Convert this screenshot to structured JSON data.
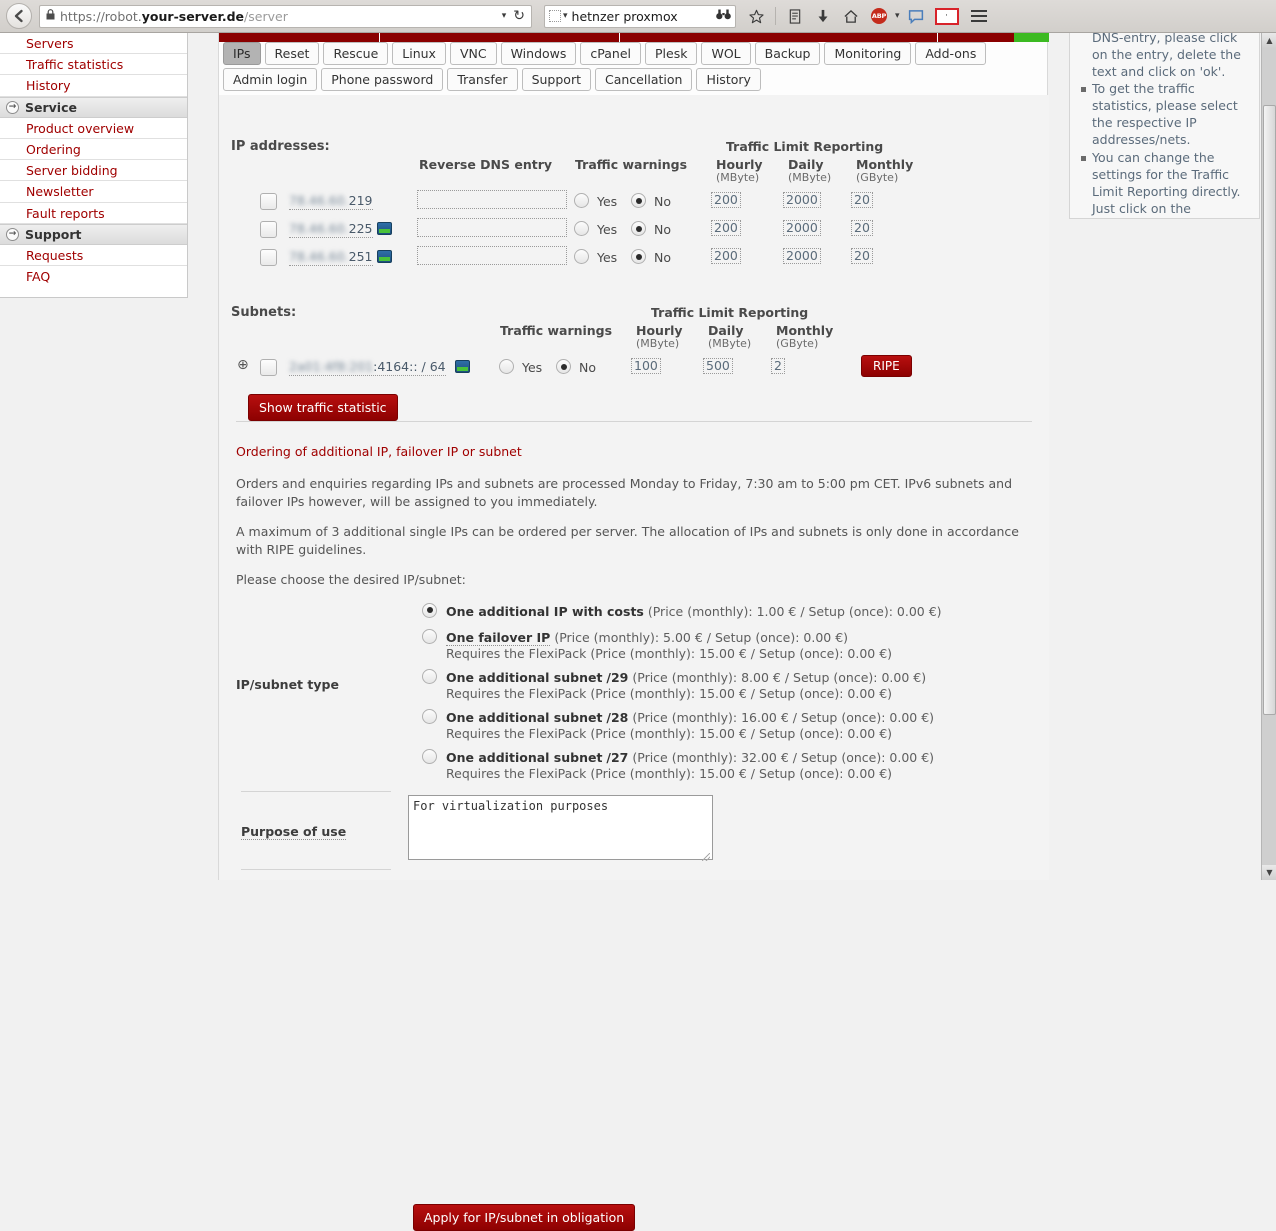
{
  "browser": {
    "back_label": "←",
    "url_scheme": "https://robot.",
    "url_domain": "your-server.de",
    "url_path": "/server",
    "url_full": "https://robot.your-server.de/server",
    "search_value": "hetnzer proxmox",
    "toolbar_icons": [
      "bookmark-star-icon",
      "library-icon",
      "downloads-icon",
      "home-icon",
      "adblock-icon",
      "chat-icon",
      "flag-icon",
      "menu-icon"
    ],
    "adblock_label": "ABP",
    "flag_label": "·"
  },
  "sidebar": {
    "items": [
      {
        "label": "Servers",
        "type": "link"
      },
      {
        "label": "Traffic statistics",
        "type": "link"
      },
      {
        "label": "History",
        "type": "link"
      },
      {
        "label": "Service",
        "type": "group"
      },
      {
        "label": "Product overview",
        "type": "link"
      },
      {
        "label": "Ordering",
        "type": "link"
      },
      {
        "label": "Server bidding",
        "type": "link"
      },
      {
        "label": "Newsletter",
        "type": "link"
      },
      {
        "label": "Fault reports",
        "type": "link"
      },
      {
        "label": "Support",
        "type": "group"
      },
      {
        "label": "Requests",
        "type": "link"
      },
      {
        "label": "FAQ",
        "type": "link"
      }
    ]
  },
  "tabs": {
    "row1": [
      "IPs",
      "Reset",
      "Rescue",
      "Linux",
      "VNC",
      "Windows",
      "cPanel",
      "Plesk",
      "WOL",
      "Backup",
      "Monitoring",
      "Add-ons"
    ],
    "row2": [
      "Admin login",
      "Phone password",
      "Transfer",
      "Support",
      "Cancellation",
      "History"
    ],
    "active": "IPs"
  },
  "ip_section": {
    "title": "IP addresses:",
    "headers": {
      "rdns": "Reverse DNS entry",
      "traffic_warnings": "Traffic warnings",
      "traffic_limit_reporting": "Traffic Limit Reporting",
      "hourly": "Hourly",
      "hourly_unit": "(MByte)",
      "daily": "Daily",
      "daily_unit": "(MByte)",
      "monthly": "Monthly",
      "monthly_unit": "(GByte)"
    },
    "yes_label": "Yes",
    "no_label": "No",
    "rows": [
      {
        "ip_blurred": "78.46.60.",
        "ip_visible": "219",
        "has_monitor_icon": false,
        "rdns": "",
        "warn_yes": false,
        "warn_no": true,
        "hourly": "200",
        "daily": "2000",
        "monthly": "20"
      },
      {
        "ip_blurred": "78.46.60.",
        "ip_visible": "225",
        "has_monitor_icon": true,
        "rdns": "",
        "warn_yes": false,
        "warn_no": true,
        "hourly": "200",
        "daily": "2000",
        "monthly": "20"
      },
      {
        "ip_blurred": "78.46.60.",
        "ip_visible": "251",
        "has_monitor_icon": true,
        "rdns": "",
        "warn_yes": false,
        "warn_no": true,
        "hourly": "200",
        "daily": "2000",
        "monthly": "20"
      }
    ]
  },
  "subnet_section": {
    "title": "Subnets:",
    "headers": {
      "traffic_warnings": "Traffic warnings",
      "traffic_limit_reporting": "Traffic Limit Reporting",
      "hourly": "Hourly",
      "hourly_unit": "(MByte)",
      "daily": "Daily",
      "daily_unit": "(MByte)",
      "monthly": "Monthly",
      "monthly_unit": "(GByte)"
    },
    "yes_label": "Yes",
    "no_label": "No",
    "expand_icon": "⊕",
    "row": {
      "subnet_blurred": "2a01:4f8:201",
      "subnet_visible": ":4164:: / 64",
      "warn_yes": false,
      "warn_no": true,
      "hourly": "100",
      "daily": "500",
      "monthly": "2",
      "ripe_label": "RIPE"
    },
    "show_traffic_button": "Show traffic statistic"
  },
  "ordering": {
    "heading": "Ordering of additional IP, failover IP or subnet",
    "para1": "Orders and enquiries regarding IPs and subnets are processed Monday to Friday, 7:30 am to 5:00 pm CET. IPv6 subnets and failover IPs however, will be assigned to you immediately.",
    "para2": "A maximum of 3 additional single IPs can be ordered per server. The allocation of IPs and subnets is only done in accordance with RIPE guidelines.",
    "para3": "Please choose the desired IP/subnet:",
    "type_label": "IP/subnet type",
    "options": [
      {
        "name": "One additional IP with costs",
        "suffix": "",
        "price": "(Price (monthly): 1.00 € / Setup (once): 0.00 €)",
        "sub": "",
        "selected": true,
        "underline": false
      },
      {
        "name": "One failover IP",
        "suffix": "",
        "price": "(Price (monthly): 5.00 € / Setup (once): 0.00 €)",
        "sub": "Requires the FlexiPack (Price (monthly): 15.00 € / Setup (once): 0.00 €)",
        "selected": false,
        "underline": true
      },
      {
        "name": "One additional subnet",
        "suffix": "/29",
        "price": "(Price (monthly): 8.00 € / Setup (once): 0.00 €)",
        "sub": "Requires the FlexiPack (Price (monthly): 15.00 € / Setup (once): 0.00 €)",
        "selected": false,
        "underline": false
      },
      {
        "name": "One additional subnet",
        "suffix": "/28",
        "price": "(Price (monthly): 16.00 € / Setup (once): 0.00 €)",
        "sub": "Requires the FlexiPack (Price (monthly): 15.00 € / Setup (once): 0.00 €)",
        "selected": false,
        "underline": false
      },
      {
        "name": "One additional subnet",
        "suffix": "/27",
        "price": "(Price (monthly): 32.00 € / Setup (once): 0.00 €)",
        "sub": "Requires the FlexiPack (Price (monthly): 15.00 € / Setup (once): 0.00 €)",
        "selected": false,
        "underline": false
      }
    ],
    "purpose_label": "Purpose of use",
    "purpose_value": "For virtualization purposes",
    "apply_button": "Apply for IP/subnet in obligation"
  },
  "help": {
    "cut_line": "DNS-entry, please click on the entry, delete the text and click on 'ok'.",
    "items": [
      "To get the traffic statistics, please select the respective IP addresses/nets.",
      "You can change the settings for the Traffic Limit Reporting directly. Just click on the concerning values."
    ]
  },
  "colors": {
    "brand_red": "#8a0000",
    "link_red": "#a00000",
    "accent_green": "#3cba22"
  }
}
